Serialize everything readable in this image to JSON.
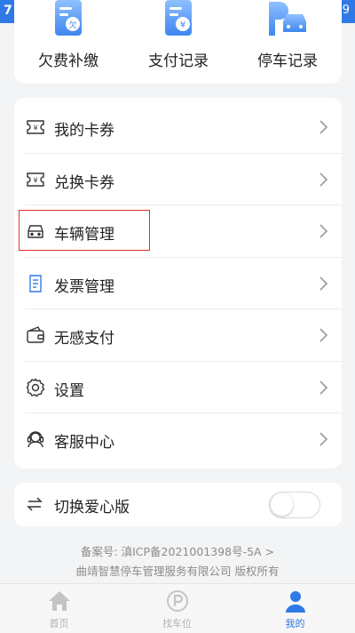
{
  "status_bar": {
    "left": "7",
    "right": "9"
  },
  "quick_actions": [
    {
      "label": "欠费补缴",
      "icon": "arrears-document-icon"
    },
    {
      "label": "支付记录",
      "icon": "payment-record-icon"
    },
    {
      "label": "停车记录",
      "icon": "parking-car-icon"
    }
  ],
  "menu": [
    {
      "label": "我的卡券",
      "icon": "coupon-icon"
    },
    {
      "label": "兑换卡券",
      "icon": "exchange-coupon-icon"
    },
    {
      "label": "车辆管理",
      "icon": "car-icon"
    },
    {
      "label": "发票管理",
      "icon": "invoice-icon"
    },
    {
      "label": "无感支付",
      "icon": "wallet-icon"
    },
    {
      "label": "设置",
      "icon": "settings-gear-icon"
    },
    {
      "label": "客服中心",
      "icon": "customer-service-icon"
    }
  ],
  "highlight": {
    "color": "#e0322b"
  },
  "care_mode": {
    "label": "切换爱心版",
    "enabled": false
  },
  "footer": {
    "icp": "备案号: 滇ICP备2021001398号-5A >",
    "copyright": "曲靖智慧停车管理服务有限公司 版权所有"
  },
  "tabs": [
    {
      "label": "首页",
      "icon": "home-icon",
      "active": false
    },
    {
      "label": "找车位",
      "icon": "parking-p-icon",
      "active": false
    },
    {
      "label": "我的",
      "icon": "user-icon",
      "active": true
    }
  ],
  "colors": {
    "accent": "#2f7ae6",
    "background": "#f3f4f6",
    "card": "#ffffff"
  }
}
